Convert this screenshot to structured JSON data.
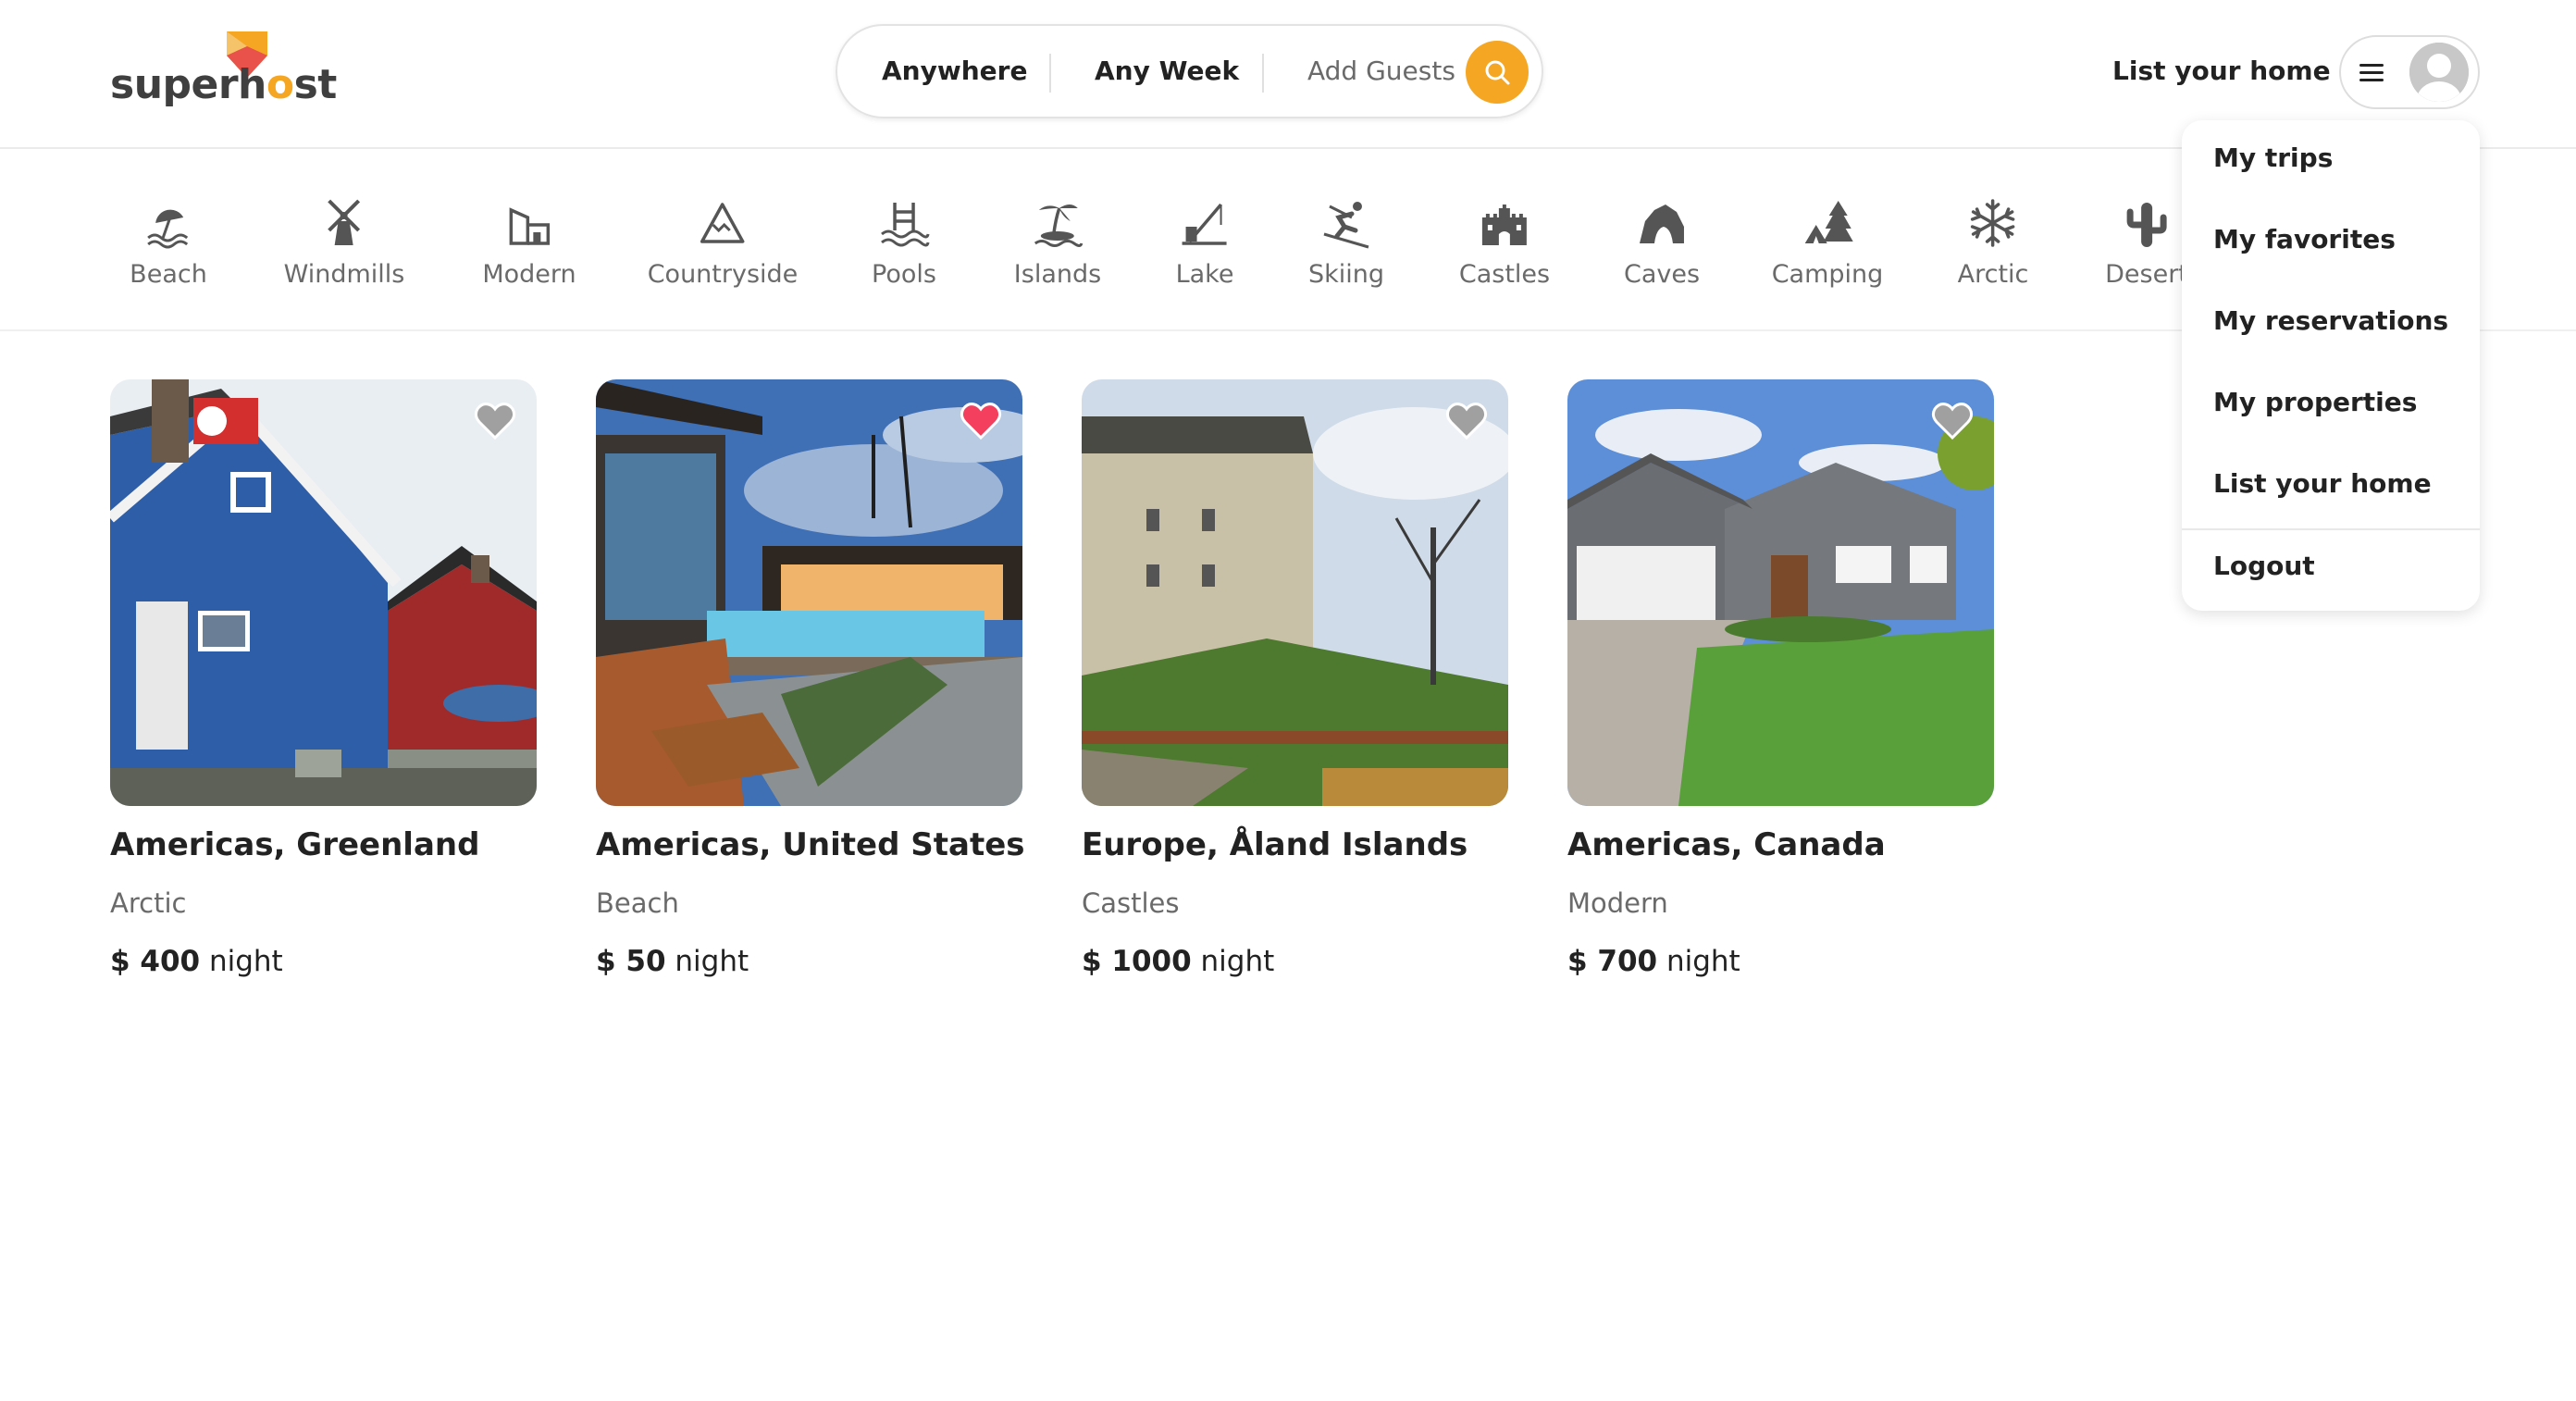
{
  "brand": {
    "name_pre": "superh",
    "name_o": "o",
    "name_post": "st",
    "accent_color": "#f5a623"
  },
  "search": {
    "location": "Anywhere",
    "week": "Any Week",
    "guests": "Add Guests"
  },
  "nav": {
    "list_home": "List your home"
  },
  "categories": [
    {
      "label": "Beach",
      "icon": "beach-icon"
    },
    {
      "label": "Windmills",
      "icon": "windmill-icon"
    },
    {
      "label": "Modern",
      "icon": "modern-building-icon"
    },
    {
      "label": "Countryside",
      "icon": "mountain-icon"
    },
    {
      "label": "Pools",
      "icon": "pool-icon"
    },
    {
      "label": "Islands",
      "icon": "island-icon"
    },
    {
      "label": "Lake",
      "icon": "lake-icon"
    },
    {
      "label": "Skiing",
      "icon": "skiing-icon"
    },
    {
      "label": "Castles",
      "icon": "castle-icon"
    },
    {
      "label": "Caves",
      "icon": "cave-icon"
    },
    {
      "label": "Camping",
      "icon": "camping-icon"
    },
    {
      "label": "Arctic",
      "icon": "snowflake-icon"
    },
    {
      "label": "Desert",
      "icon": "cactus-icon"
    }
  ],
  "listings": [
    {
      "location": "Americas, Greenland",
      "category": "Arctic",
      "currency": "$",
      "price": "400",
      "unit": "night",
      "favorited": false
    },
    {
      "location": "Americas, United States",
      "category": "Beach",
      "currency": "$",
      "price": "50",
      "unit": "night",
      "favorited": true
    },
    {
      "location": "Europe, Åland Islands",
      "category": "Castles",
      "currency": "$",
      "price": "1000",
      "unit": "night",
      "favorited": false
    },
    {
      "location": "Americas, Canada",
      "category": "Modern",
      "currency": "$",
      "price": "700",
      "unit": "night",
      "favorited": false
    }
  ],
  "user_menu": {
    "items": [
      "My trips",
      "My favorites",
      "My reservations",
      "My properties",
      "List your home"
    ],
    "logout": "Logout"
  },
  "colors": {
    "heart_active": "#f43f5e",
    "heart_inactive": "#a0a0a0"
  }
}
